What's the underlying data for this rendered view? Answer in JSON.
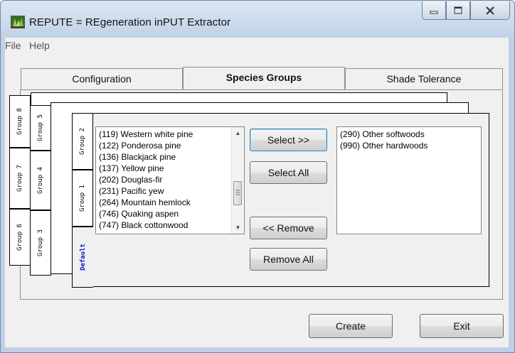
{
  "window": {
    "title": "REPUTE = REgeneration inPUT Extractor"
  },
  "menu": {
    "file": "File",
    "help": "Help"
  },
  "tabs": [
    {
      "label": "Configuration"
    },
    {
      "label": "Species Groups",
      "active": true
    },
    {
      "label": "Shade Tolerance"
    }
  ],
  "group_tabs": {
    "back": [
      "Group 8",
      "Group 7",
      "Group 6"
    ],
    "middle": [
      "Group 5",
      "Group 4",
      "Group 3"
    ],
    "front": [
      "Group 2",
      "Group 1",
      "Default"
    ]
  },
  "available_species": [
    "(119) Western white pine",
    "(122) Ponderosa pine",
    "(136) Blackjack pine",
    "(137) Yellow pine",
    "(202) Douglas-fir",
    "(231) Pacific yew",
    "(264) Mountain hemlock",
    "(746) Quaking aspen",
    "(747) Black cottonwood"
  ],
  "selected_species": [
    "(290) Other softwoods",
    "(990) Other hardwoods"
  ],
  "buttons": {
    "select": "Select >>",
    "select_all": "Select All",
    "remove": "<< Remove",
    "remove_all": "Remove All",
    "create": "Create",
    "exit": "Exit"
  }
}
